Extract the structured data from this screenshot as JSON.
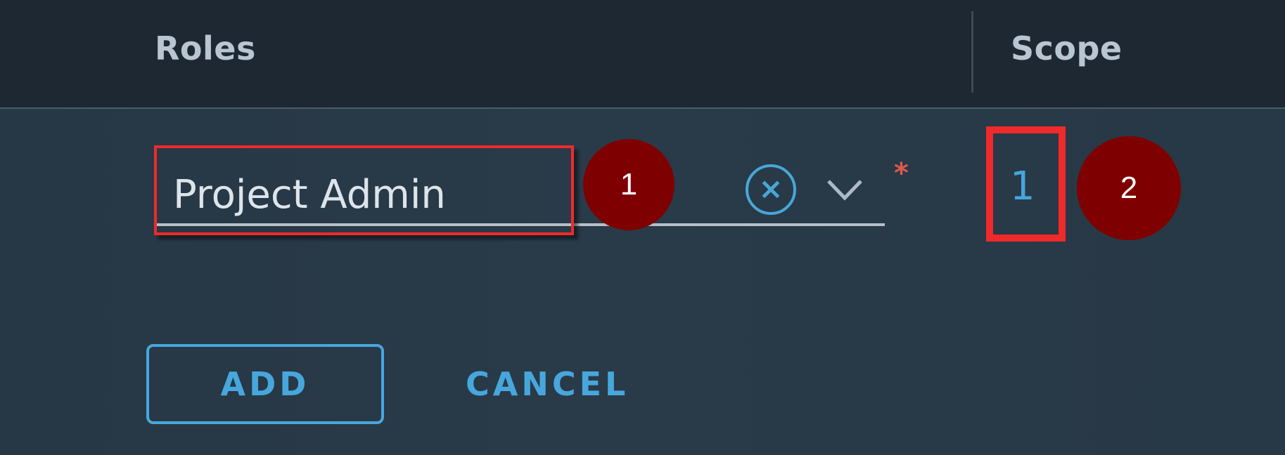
{
  "table": {
    "columns": {
      "roles": "Roles",
      "scope": "Scope"
    },
    "row": {
      "role_value": "Project Admin",
      "required_marker": "*",
      "scope_value": "1",
      "clear_icon": "x-circle-icon",
      "dropdown_icon": "chevron-down-icon"
    }
  },
  "actions": {
    "add_label": "ADD",
    "cancel_label": "CANCEL"
  },
  "annotations": {
    "marker_1": "1",
    "marker_2": "2"
  },
  "colors": {
    "accent": "#47a7dc",
    "highlight": "#f02a2a",
    "marker": "#7f0000",
    "required": "#e0594a"
  }
}
